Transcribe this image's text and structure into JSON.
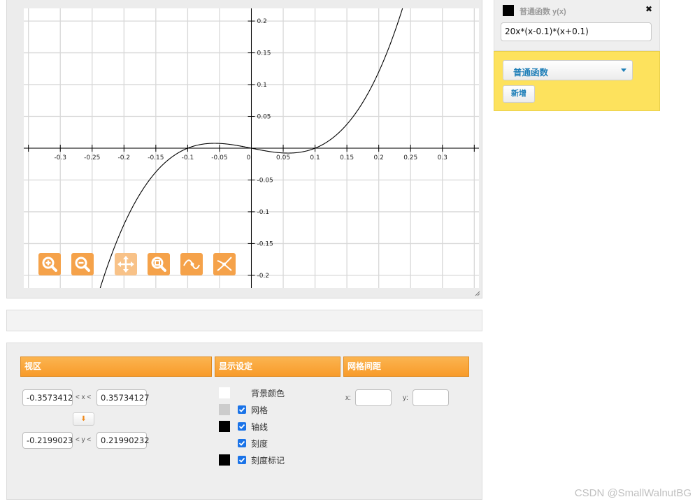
{
  "graph": {
    "x_ticks": [
      "-0.3",
      "-0.25",
      "-0.2",
      "-0.15",
      "-0.1",
      "-0.05",
      "0",
      "0.05",
      "0.1",
      "0.15",
      "0.2",
      "0.25",
      "0.3"
    ],
    "y_ticks": [
      "0.2",
      "0.15",
      "0.1",
      "0.05",
      "0",
      "-0.05",
      "-0.1",
      "-0.15",
      "-0.2"
    ],
    "view": {
      "xmin": -0.3573412,
      "xmax": 0.35734127,
      "ymin": -0.2199023,
      "ymax": 0.21990232
    },
    "function_expr": "20x*(x-0.1)*(x+0.1)",
    "curve_color": "#000000",
    "toolbar": [
      {
        "name": "zoom-in-icon"
      },
      {
        "name": "zoom-out-icon"
      },
      {
        "name": "move-icon"
      },
      {
        "name": "zoom-fit-icon"
      },
      {
        "name": "trace-point-icon"
      },
      {
        "name": "intersection-icon"
      }
    ]
  },
  "function_panel": {
    "color": "#000000",
    "title": "普通函数 y(x)",
    "close_symbol": "✖",
    "expression": "20x*(x-0.1)*(x+0.1)",
    "type_select": "普通函数",
    "add_button": "新增"
  },
  "settings": {
    "viewport": {
      "header": "视区",
      "xmin": "-0.3573412",
      "xmax": "0.35734127",
      "x_label": "< x <",
      "ymin": "-0.2199023",
      "ymax": "0.21990232",
      "y_label": "< y <",
      "swap_symbol": "⬇"
    },
    "display": {
      "header": "显示设定",
      "options": [
        {
          "label": "背景颜色",
          "color": "#ffffff",
          "checked": null
        },
        {
          "label": "网格",
          "color": "#cccccc",
          "checked": true
        },
        {
          "label": "轴线",
          "color": "#000000",
          "checked": true
        },
        {
          "label": "刻度",
          "color": null,
          "checked": true
        },
        {
          "label": "刻度标记",
          "color": "#000000",
          "checked": true
        }
      ]
    },
    "grid_spacing": {
      "header": "网格间距",
      "x_label": "x:",
      "y_label": "y:",
      "x_value": "",
      "y_value": ""
    }
  },
  "watermark": "CSDN @SmallWalnutBG",
  "colors": {
    "accent": "#f89b2a",
    "toolbar": "#f5a24a",
    "yellow_panel": "#fde25d",
    "link_blue": "#1f7fb8"
  }
}
